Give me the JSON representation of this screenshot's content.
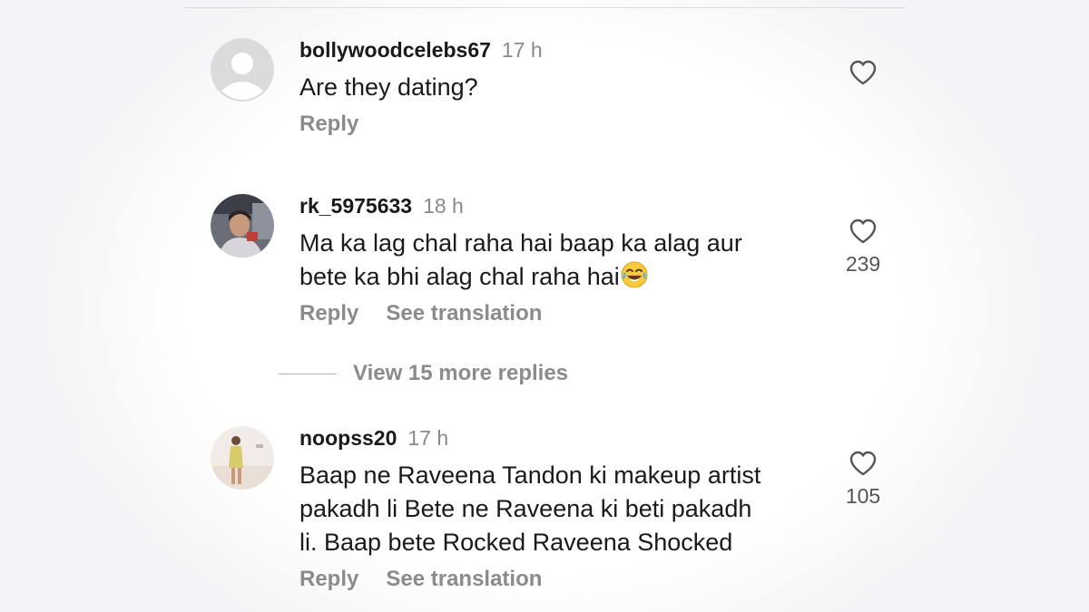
{
  "comments": [
    {
      "username": "bollywoodceleb s67",
      "time": "17 h",
      "text": "Are they dating?",
      "reply_label": "Reply",
      "like_count": ""
    },
    {
      "username": "rk_5975633",
      "time": "18 h",
      "text_line1": "Ma ka lag chal raha hai baap ka alag aur",
      "text_line2": "bete ka bhi alag chal raha hai",
      "reply_label": "Reply",
      "translate_label": "See translation",
      "like_count": "239"
    },
    {
      "username": "noopss20",
      "time": "17 h",
      "text_line1": "Baap ne Raveena Tandon ki makeup artist",
      "text_line2": "pakadh li Bete ne Raveena ki beti pakadh",
      "text_line3": "li. Baap bete Rocked Raveena Shocked",
      "reply_label": "Reply",
      "translate_label": "See translation",
      "like_count": "105"
    }
  ],
  "view_replies": {
    "label": "View 15 more replies"
  },
  "icons": {
    "like": "heart-outline-icon",
    "emoji": "laughing-tears-emoji-icon",
    "default_avatar": "default-avatar-icon"
  },
  "colors": {
    "background": "#ffffff",
    "secondary_text": "#8b8b8b",
    "primary_text": "#1a1a1a"
  }
}
